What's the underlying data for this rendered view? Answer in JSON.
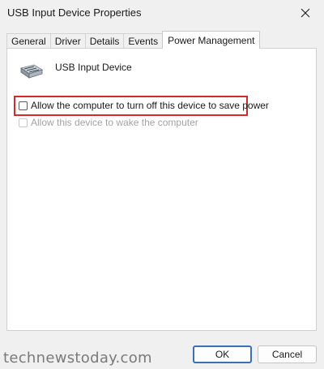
{
  "window": {
    "title": "USB Input Device Properties"
  },
  "tabs": [
    {
      "label": "General"
    },
    {
      "label": "Driver"
    },
    {
      "label": "Details"
    },
    {
      "label": "Events"
    },
    {
      "label": "Power Management"
    }
  ],
  "active_tab": "Power Management",
  "device": {
    "name": "USB Input Device",
    "icon": "usb-device-icon"
  },
  "options": [
    {
      "label": "Allow the computer to turn off this device to save power",
      "checked": false,
      "enabled": true
    },
    {
      "label": "Allow this device to wake the computer",
      "checked": false,
      "enabled": false
    }
  ],
  "buttons": {
    "ok": "OK",
    "cancel": "Cancel"
  },
  "watermark": "technewstoday.com",
  "colors": {
    "highlight": "#d62a2a",
    "default_button_border": "#3b6fb6"
  }
}
